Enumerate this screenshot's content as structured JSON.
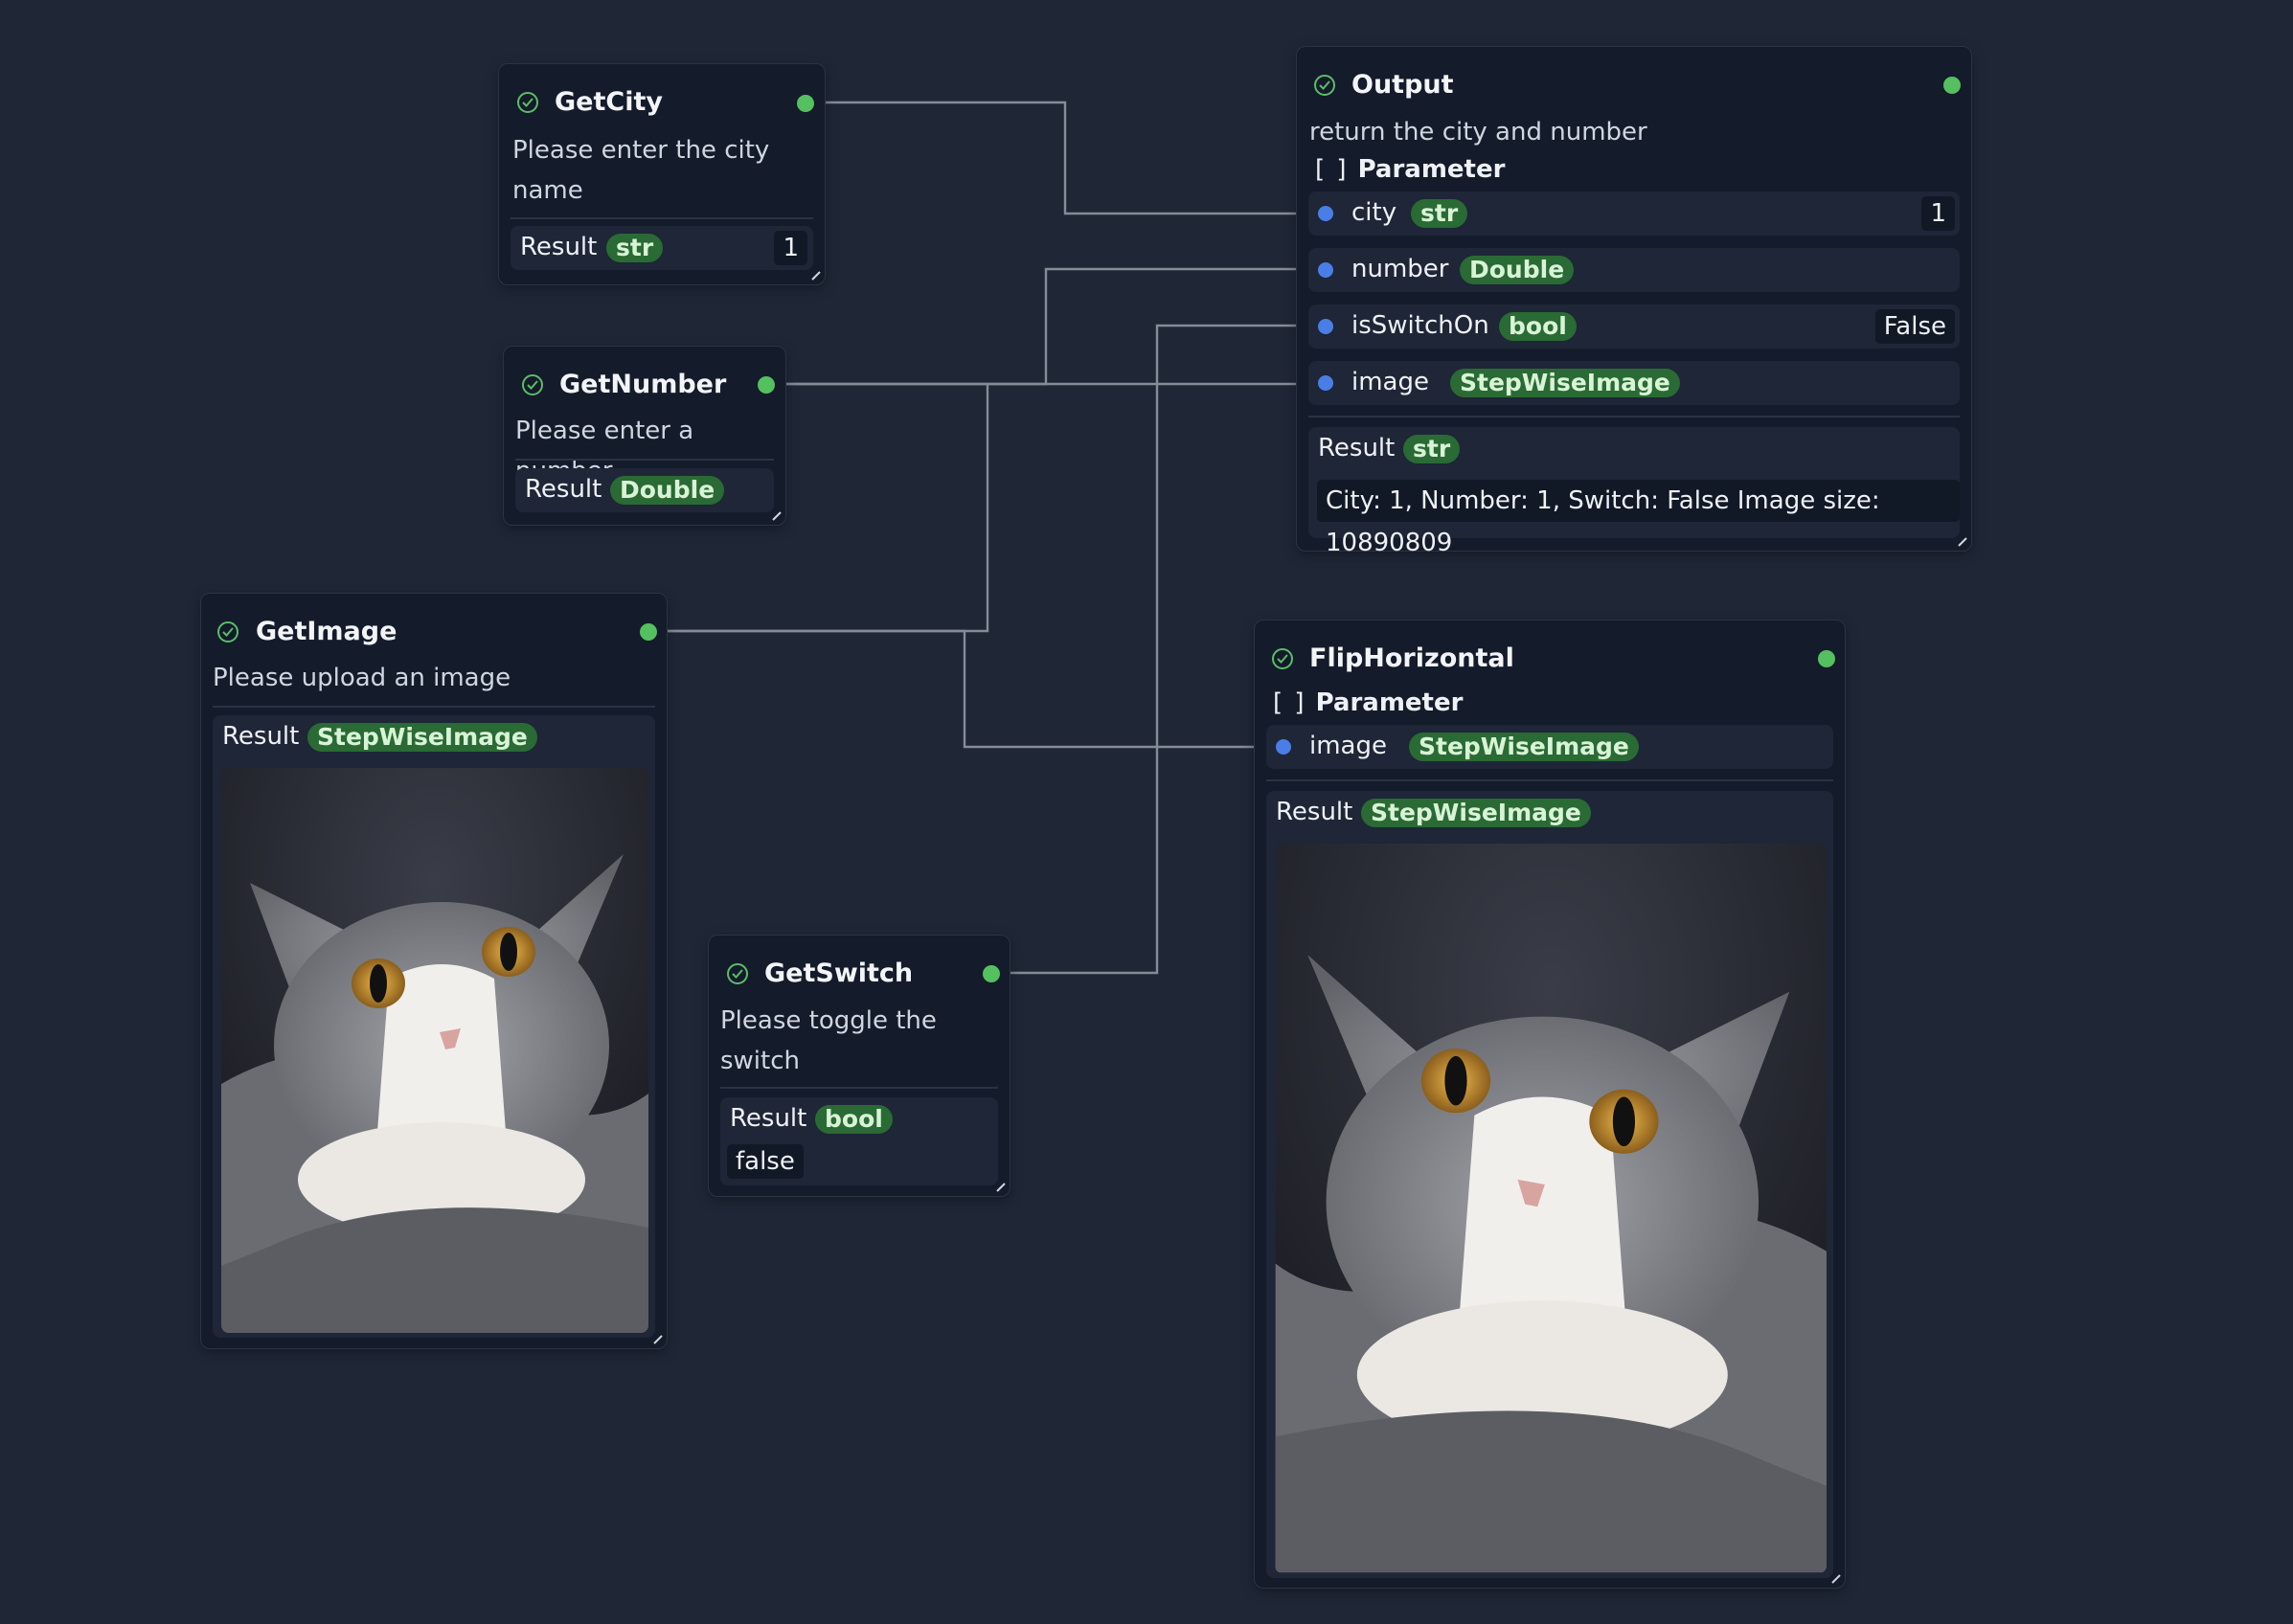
{
  "nodes": {
    "get_city": {
      "title": "GetCity",
      "description_line1": "Please enter the city",
      "description_line2": "name",
      "result_label": "Result",
      "result_type": "str",
      "result_value": "1"
    },
    "get_number": {
      "title": "GetNumber",
      "description": "Please enter a number",
      "result_label": "Result",
      "result_type": "Double"
    },
    "get_image": {
      "title": "GetImage",
      "description": "Please upload an image",
      "result_label": "Result",
      "result_type": "StepWiseImage"
    },
    "get_switch": {
      "title": "GetSwitch",
      "description_line1": "Please toggle the",
      "description_line2": "switch",
      "result_label": "Result",
      "result_type": "bool",
      "result_value": "false"
    },
    "output": {
      "title": "Output",
      "description": "return the city and number",
      "parameter_header": "Parameter",
      "bracket_icon": "[ ]",
      "params": [
        {
          "name": "city",
          "type": "str",
          "value": "1"
        },
        {
          "name": "number",
          "type": "Double"
        },
        {
          "name": "isSwitchOn",
          "type": "bool",
          "value": "False"
        },
        {
          "name": "image",
          "type": "StepWiseImage"
        }
      ],
      "result_label": "Result",
      "result_type": "str",
      "result_value": "City: 1, Number: 1, Switch: False Image size: 10890809"
    },
    "flip_horizontal": {
      "title": "FlipHorizontal",
      "parameter_header": "Parameter",
      "bracket_icon": "[ ]",
      "params": [
        {
          "name": "image",
          "type": "StepWiseImage"
        }
      ],
      "result_label": "Result",
      "result_type": "StepWiseImage"
    }
  },
  "colors": {
    "background": "#1f2737",
    "node": "#141b2a",
    "output_port": "#54c060",
    "input_port": "#4a7ee6",
    "type_badge": "#2a6a34",
    "wire": "#858c96"
  },
  "icons": {
    "status": "check-circle-icon",
    "resize": "resize-handle-icon",
    "image": "cat-photo"
  }
}
